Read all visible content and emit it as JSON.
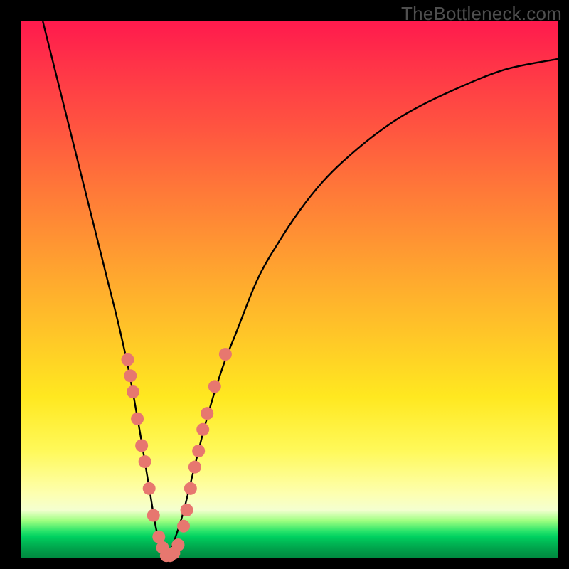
{
  "watermark": "TheBottleneck.com",
  "chart_data": {
    "type": "line",
    "title": "",
    "xlabel": "",
    "ylabel": "",
    "xlim": [
      0,
      100
    ],
    "ylim": [
      0,
      100
    ],
    "grid": false,
    "legend": false,
    "series": [
      {
        "name": "bottleneck-curve",
        "color": "#000000",
        "x": [
          4,
          6,
          8,
          10,
          12,
          14,
          16,
          18,
          20,
          22,
          23,
          24,
          25,
          26,
          27,
          28,
          30,
          32,
          34,
          36,
          38,
          40,
          44,
          48,
          52,
          56,
          60,
          66,
          72,
          80,
          90,
          100
        ],
        "y": [
          100,
          92,
          84,
          76,
          68,
          60,
          52,
          44,
          35,
          24,
          18,
          12,
          6,
          2,
          0,
          2,
          8,
          16,
          24,
          31,
          37,
          42,
          52,
          59,
          65,
          70,
          74,
          79,
          83,
          87,
          91,
          93
        ]
      }
    ],
    "markers": [
      {
        "name": "left-branch-dots",
        "color": "#e7776f",
        "points": [
          {
            "x": 19.8,
            "y": 37
          },
          {
            "x": 20.3,
            "y": 34
          },
          {
            "x": 20.8,
            "y": 31
          },
          {
            "x": 21.6,
            "y": 26
          },
          {
            "x": 22.4,
            "y": 21
          },
          {
            "x": 23.0,
            "y": 18
          },
          {
            "x": 23.8,
            "y": 13
          },
          {
            "x": 24.6,
            "y": 8
          },
          {
            "x": 25.6,
            "y": 4
          },
          {
            "x": 26.3,
            "y": 2
          },
          {
            "x": 27.0,
            "y": 0.5
          },
          {
            "x": 27.7,
            "y": 0.5
          },
          {
            "x": 28.4,
            "y": 1.0
          },
          {
            "x": 29.2,
            "y": 2.5
          }
        ]
      },
      {
        "name": "right-branch-dots",
        "color": "#e7776f",
        "points": [
          {
            "x": 30.2,
            "y": 6
          },
          {
            "x": 30.8,
            "y": 9
          },
          {
            "x": 31.5,
            "y": 13
          },
          {
            "x": 32.3,
            "y": 17
          },
          {
            "x": 33.0,
            "y": 20
          },
          {
            "x": 33.8,
            "y": 24
          },
          {
            "x": 34.6,
            "y": 27
          },
          {
            "x": 36.0,
            "y": 32
          },
          {
            "x": 38.0,
            "y": 38
          }
        ]
      }
    ]
  }
}
